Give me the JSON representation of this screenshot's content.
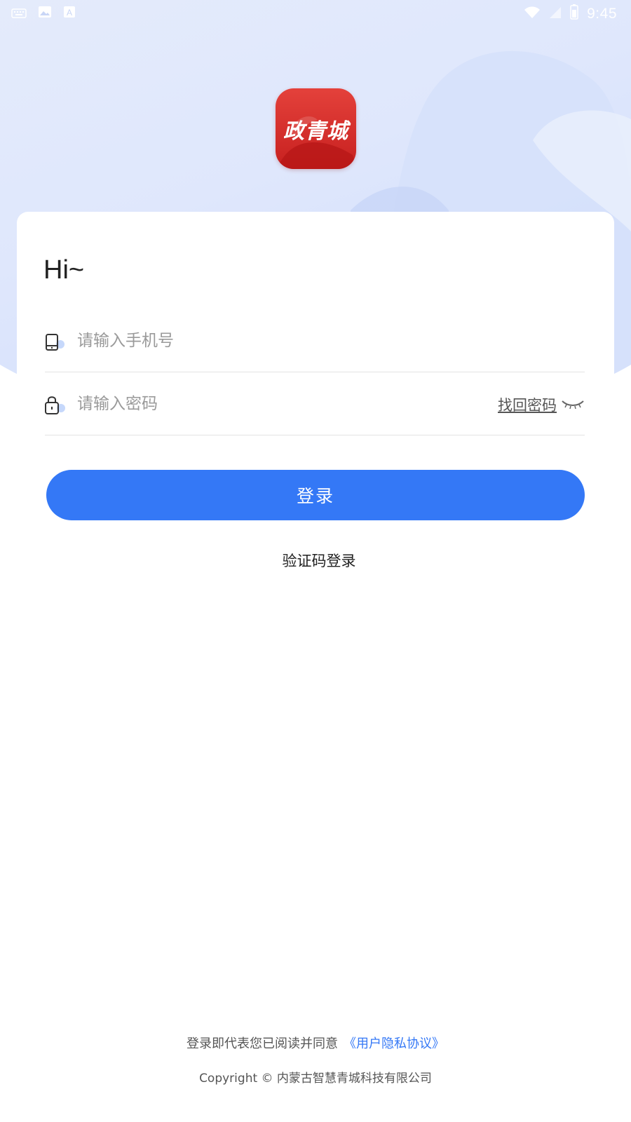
{
  "status_bar": {
    "time": "9:45"
  },
  "app": {
    "logo_text": "政青城",
    "brand_color": "#d8302c",
    "accent_color": "#3478f6"
  },
  "login": {
    "greeting": "Hi~",
    "phone": {
      "placeholder": "请输入手机号",
      "value": "",
      "icon": "phone-icon"
    },
    "password": {
      "placeholder": "请输入密码",
      "value": "",
      "icon": "lock-icon",
      "forgot_label": "找回密码",
      "toggle_icon": "eye-closed-icon"
    },
    "submit_label": "登录",
    "sms_login_label": "验证码登录"
  },
  "footer": {
    "agreement_prefix": "登录即代表您已阅读并同意",
    "agreement_link": "《用户隐私协议》",
    "copyright": "Copyright © 内蒙古智慧青城科技有限公司"
  }
}
